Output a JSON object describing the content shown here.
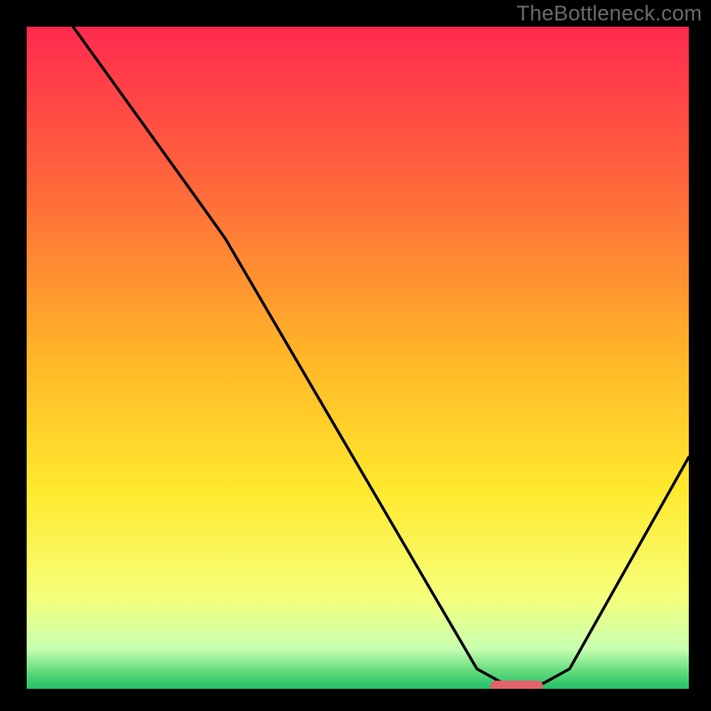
{
  "attribution": "TheBottleneck.com",
  "chart_data": {
    "type": "line",
    "title": "",
    "xlabel": "",
    "ylabel": "",
    "xlim": [
      0,
      100
    ],
    "ylim": [
      0,
      100
    ],
    "background": {
      "gradient_stops": [
        {
          "offset": 0.0,
          "color": "#ff2a4f"
        },
        {
          "offset": 0.25,
          "color": "#ff6a3a"
        },
        {
          "offset": 0.5,
          "color": "#ffb627"
        },
        {
          "offset": 0.7,
          "color": "#ffe92e"
        },
        {
          "offset": 0.86,
          "color": "#f6ff7a"
        },
        {
          "offset": 0.94,
          "color": "#c7ffb0"
        },
        {
          "offset": 0.975,
          "color": "#5fd97a"
        },
        {
          "offset": 1.0,
          "color": "#22c06a"
        }
      ],
      "note": "Vertical red→orange→yellow→green gradient fills the plot area."
    },
    "series": [
      {
        "name": "bottleneck-curve",
        "color": "#000000",
        "points": [
          {
            "x": 7,
            "y": 100
          },
          {
            "x": 25,
            "y": 75
          },
          {
            "x": 30,
            "y": 68
          },
          {
            "x": 68,
            "y": 3
          },
          {
            "x": 72,
            "y": 0.8
          },
          {
            "x": 78,
            "y": 0.8
          },
          {
            "x": 82,
            "y": 3
          },
          {
            "x": 100,
            "y": 35
          }
        ]
      }
    ],
    "markers": [
      {
        "name": "optimal-band",
        "shape": "rounded-bar",
        "color": "#e3636a",
        "x_start": 70,
        "x_end": 78,
        "y": 0.5,
        "height_pct": 1.5
      }
    ]
  }
}
